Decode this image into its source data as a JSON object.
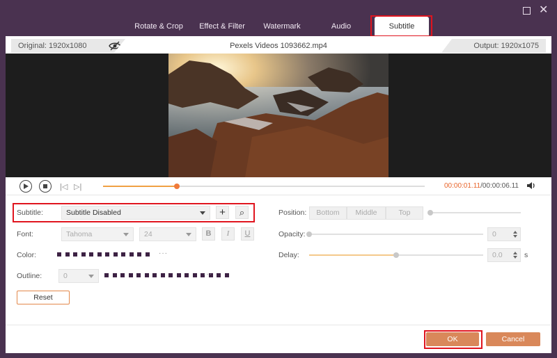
{
  "window": {
    "maximize_icon": "maximize-icon",
    "close_icon": "close-icon",
    "close_glyph": "✕"
  },
  "tabs": [
    {
      "label": "Rotate & Crop",
      "active": false
    },
    {
      "label": "Effect & Filter",
      "active": false
    },
    {
      "label": "Watermark",
      "active": false
    },
    {
      "label": "Audio",
      "active": false
    },
    {
      "label": "Subtitle",
      "active": true
    }
  ],
  "info": {
    "original": "Original: 1920x1080",
    "filename": "Pexels Videos 1093662.mp4",
    "output": "Output: 1920x1075",
    "eye_icon": "eye-slash-icon"
  },
  "player": {
    "prev_glyph": "|◁",
    "next_glyph": "▷|",
    "current_time": "00:00:01.11",
    "total_time": "/00:00:06.11",
    "progress": 0.23
  },
  "subtitle": {
    "label": "Subtitle:",
    "value": "Subtitle Disabled",
    "add_glyph": "+",
    "search_glyph": "⌕"
  },
  "font": {
    "label": "Font:",
    "family": "Tahoma",
    "size": "24",
    "bold": "B",
    "italic": "I",
    "underline": "U"
  },
  "color": {
    "label": "Color:",
    "swatches": [
      "#3d2244",
      "#3d2244",
      "#3d2244",
      "#3d2244",
      "#3d2244",
      "#3d2244",
      "#3d2244",
      "#3d2244",
      "#3d2244",
      "#3d2244",
      "#3d2244",
      "#3d2244"
    ],
    "more": "···"
  },
  "outline": {
    "label": "Outline:",
    "value": "0",
    "swatches": [
      "#3d2244",
      "#3d2244",
      "#3d2244",
      "#3d2244",
      "#3d2244",
      "#3d2244",
      "#3d2244",
      "#3d2244",
      "#3d2244",
      "#3d2244",
      "#3d2244",
      "#3d2244",
      "#3d2244",
      "#3d2244",
      "#3d2244",
      "#3d2244"
    ],
    "more": "···"
  },
  "reset_label": "Reset",
  "position": {
    "label": "Position:",
    "options": [
      "Bottom",
      "Middle",
      "Top"
    ],
    "slider": 0.0
  },
  "opacity": {
    "label": "Opacity:",
    "value": "0",
    "slider": 0.0
  },
  "delay": {
    "label": "Delay:",
    "value": "0.0",
    "unit": "s",
    "slider": 0.5
  },
  "footer": {
    "ok_label": "OK",
    "cancel_label": "Cancel"
  },
  "colors": {
    "accent": "#d9885a",
    "highlight": "#e0141e",
    "background": "#4a3250"
  }
}
